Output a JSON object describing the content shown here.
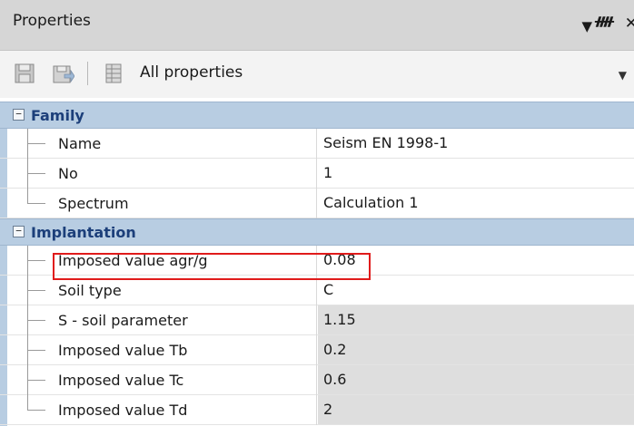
{
  "panel": {
    "title": "Properties",
    "controls": {
      "dropdown": "▼",
      "pin": "ᚎ",
      "close": "✕"
    }
  },
  "toolbar": {
    "filter_label": "All properties",
    "icons": [
      "save-icon",
      "save-as-icon",
      "table-properties-icon"
    ]
  },
  "categories": [
    {
      "label": "Family",
      "toggle": "−",
      "rows": [
        {
          "name": "Name",
          "value": "Seism EN 1998-1",
          "readonly": false
        },
        {
          "name": "No",
          "value": "1",
          "readonly": false
        },
        {
          "name": "Spectrum",
          "value": "Calculation 1",
          "readonly": false
        }
      ]
    },
    {
      "label": "Implantation",
      "toggle": "−",
      "rows": [
        {
          "name": "Imposed value agr/g",
          "value": "0.08",
          "readonly": false,
          "highlighted": true
        },
        {
          "name": "Soil type",
          "value": "C",
          "readonly": false
        },
        {
          "name": "S - soil parameter",
          "value": "1.15",
          "readonly": true
        },
        {
          "name": "Imposed value Tb",
          "value": "0.2",
          "readonly": true
        },
        {
          "name": "Imposed value Tc",
          "value": "0.6",
          "readonly": true
        },
        {
          "name": "Imposed value Td",
          "value": "2",
          "readonly": true
        }
      ]
    }
  ],
  "colors": {
    "category_bg": "#b8cde2",
    "category_text": "#1c3f7a",
    "highlight": "#e01b1b",
    "readonly_bg": "#dedede"
  }
}
